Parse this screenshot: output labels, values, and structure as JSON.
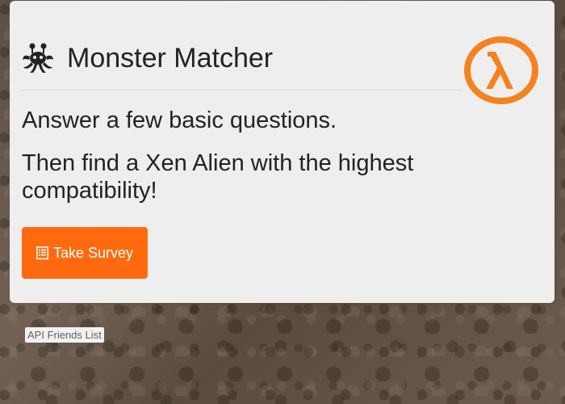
{
  "header": {
    "title": "Monster Matcher",
    "title_icon": "monster-icon",
    "logo_icon": "lambda-logo-icon"
  },
  "main": {
    "lead_line_1": "Answer a few basic questions.",
    "lead_line_2": "Then find a Xen Alien with the highest compatibility!",
    "survey_button": {
      "icon": "list-alt-icon",
      "label": "Take Survey"
    }
  },
  "footer": {
    "api_link_label": "API Friends List"
  },
  "colors": {
    "accent": "#ff6a0f",
    "panel": "#eeeeee",
    "text": "#222222",
    "logo": "#f58220"
  }
}
